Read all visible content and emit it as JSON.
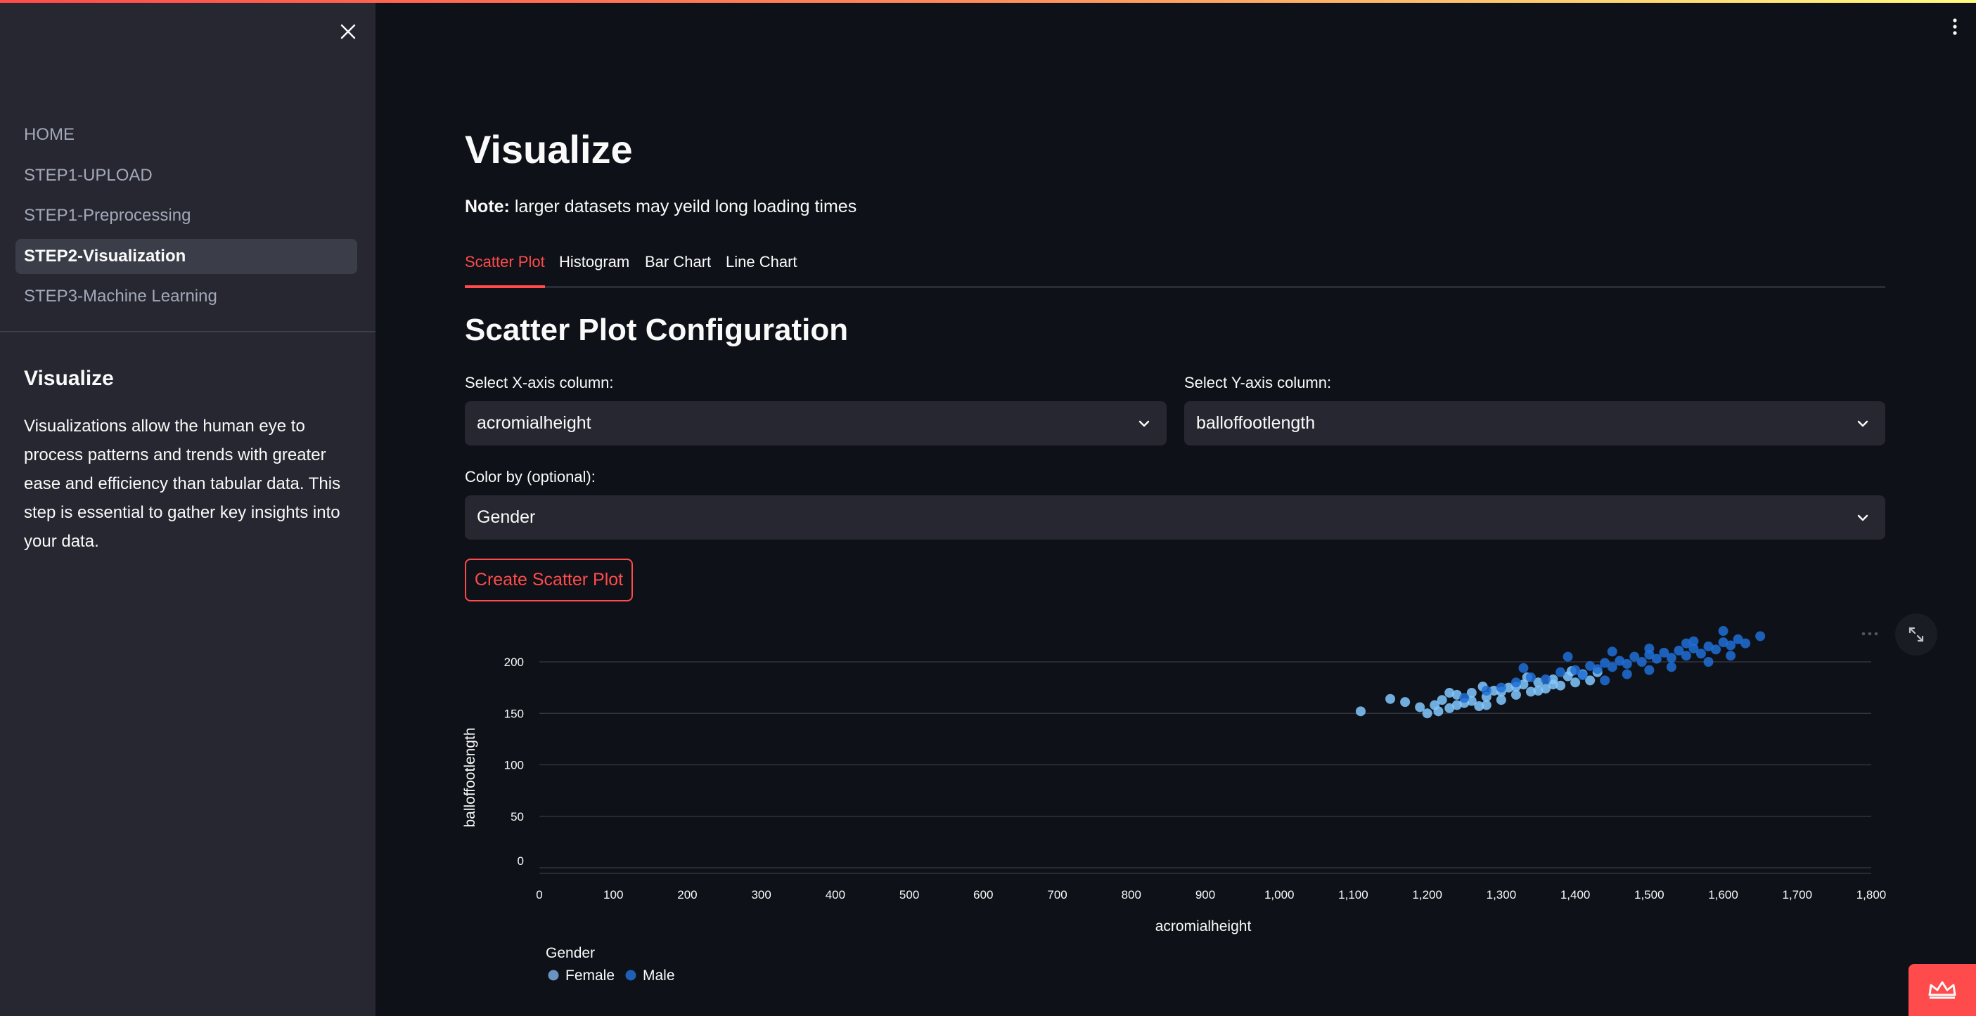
{
  "sidebar": {
    "items": [
      {
        "label": "HOME"
      },
      {
        "label": "STEP1-UPLOAD"
      },
      {
        "label": "STEP1-Preprocessing"
      },
      {
        "label": "STEP2-Visualization"
      },
      {
        "label": "STEP3-Machine Learning"
      }
    ],
    "active_index": 3,
    "section_title": "Visualize",
    "section_text": "Visualizations allow the human eye to process patterns and trends with greater ease and efficiency than tabular data. This step is essential to gather key insights into your data."
  },
  "main": {
    "title": "Visualize",
    "note_bold": "Note:",
    "note_text": " larger datasets may yeild long loading times",
    "tabs": [
      {
        "label": "Scatter Plot"
      },
      {
        "label": "Histogram"
      },
      {
        "label": "Bar Chart"
      },
      {
        "label": "Line Chart"
      }
    ],
    "active_tab": 0,
    "config_title": "Scatter Plot Configuration",
    "x_label": "Select X-axis column:",
    "x_value": "acromialheight",
    "y_label": "Select Y-axis column:",
    "y_value": "balloffootlength",
    "color_label": "Color by (optional):",
    "color_value": "Gender",
    "button": "Create Scatter Plot"
  },
  "colors": {
    "accent": "#ff4b4b",
    "female": "#83c9ff",
    "male": "#1f6fd6"
  },
  "chart_data": {
    "type": "scatter",
    "xlabel": "acromialheight",
    "ylabel": "balloffootlength",
    "xlim": [
      0,
      1800
    ],
    "ylim": [
      0,
      200
    ],
    "x_ticks": [
      "0",
      "100",
      "200",
      "300",
      "400",
      "500",
      "600",
      "700",
      "800",
      "900",
      "1,000",
      "1,100",
      "1,200",
      "1,300",
      "1,400",
      "1,500",
      "1,600",
      "1,700",
      "1,800"
    ],
    "y_ticks": [
      "0",
      "50",
      "100",
      "150",
      "200"
    ],
    "legend_title": "Gender",
    "legend_position": "bottom-left",
    "grid": true,
    "series": [
      {
        "name": "Female",
        "points": [
          [
            1110,
            152
          ],
          [
            1150,
            164
          ],
          [
            1170,
            161
          ],
          [
            1190,
            156
          ],
          [
            1200,
            150
          ],
          [
            1210,
            158
          ],
          [
            1220,
            163
          ],
          [
            1230,
            155
          ],
          [
            1240,
            168
          ],
          [
            1250,
            160
          ],
          [
            1260,
            170
          ],
          [
            1270,
            157
          ],
          [
            1280,
            166
          ],
          [
            1290,
            172
          ],
          [
            1300,
            163
          ],
          [
            1310,
            175
          ],
          [
            1320,
            168
          ],
          [
            1330,
            178
          ],
          [
            1340,
            171
          ],
          [
            1350,
            180
          ],
          [
            1360,
            174
          ],
          [
            1370,
            183
          ],
          [
            1380,
            177
          ],
          [
            1390,
            186
          ],
          [
            1400,
            180
          ],
          [
            1410,
            188
          ],
          [
            1420,
            182
          ],
          [
            1430,
            190
          ],
          [
            1240,
            158
          ],
          [
            1260,
            162
          ],
          [
            1280,
            158
          ],
          [
            1300,
            171
          ],
          [
            1320,
            176
          ],
          [
            1350,
            172
          ],
          [
            1370,
            178
          ],
          [
            1230,
            170
          ],
          [
            1215,
            152
          ],
          [
            1275,
            176
          ],
          [
            1335,
            185
          ],
          [
            1395,
            191
          ]
        ]
      },
      {
        "name": "Male",
        "points": [
          [
            1250,
            165
          ],
          [
            1280,
            172
          ],
          [
            1300,
            175
          ],
          [
            1320,
            180
          ],
          [
            1340,
            185
          ],
          [
            1360,
            183
          ],
          [
            1380,
            190
          ],
          [
            1400,
            192
          ],
          [
            1410,
            187
          ],
          [
            1420,
            196
          ],
          [
            1430,
            193
          ],
          [
            1440,
            199
          ],
          [
            1450,
            195
          ],
          [
            1460,
            201
          ],
          [
            1470,
            198
          ],
          [
            1480,
            205
          ],
          [
            1490,
            200
          ],
          [
            1500,
            207
          ],
          [
            1510,
            203
          ],
          [
            1520,
            209
          ],
          [
            1530,
            204
          ],
          [
            1540,
            211
          ],
          [
            1550,
            206
          ],
          [
            1560,
            213
          ],
          [
            1570,
            208
          ],
          [
            1580,
            215
          ],
          [
            1590,
            212
          ],
          [
            1600,
            219
          ],
          [
            1610,
            216
          ],
          [
            1620,
            222
          ],
          [
            1630,
            218
          ],
          [
            1650,
            225
          ],
          [
            1390,
            205
          ],
          [
            1450,
            210
          ],
          [
            1500,
            213
          ],
          [
            1550,
            218
          ],
          [
            1470,
            188
          ],
          [
            1530,
            195
          ],
          [
            1580,
            200
          ],
          [
            1610,
            206
          ],
          [
            1330,
            194
          ],
          [
            1600,
            230
          ],
          [
            1560,
            220
          ],
          [
            1440,
            182
          ],
          [
            1500,
            192
          ]
        ]
      }
    ]
  }
}
